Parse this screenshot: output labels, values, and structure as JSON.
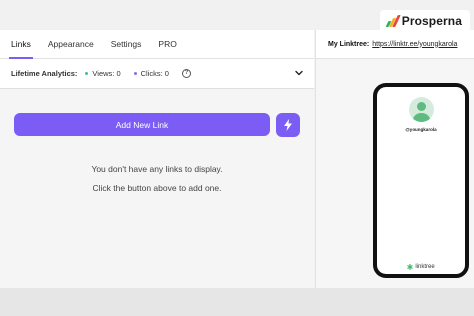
{
  "brand": {
    "name": "Prosperna"
  },
  "tabs": [
    {
      "label": "Links",
      "active": true
    },
    {
      "label": "Appearance",
      "active": false
    },
    {
      "label": "Settings",
      "active": false
    },
    {
      "label": "PRO",
      "active": false
    }
  ],
  "analytics": {
    "label": "Lifetime Analytics:",
    "views": "Views: 0",
    "clicks": "Clicks: 0",
    "help_icon": "?",
    "chevron_icon": "chevron-down-icon"
  },
  "actions": {
    "add_link_label": "Add New Link",
    "bolt_icon": "lightning-icon"
  },
  "empty_state": {
    "line1": "You don't have any links to display.",
    "line2": "Click the button above to add one."
  },
  "preview": {
    "my_linktree_label": "My Linktree:",
    "url": "https://linktr.ee/youngkarola",
    "handle": "@youngkarola",
    "footer": "linktree"
  },
  "colors": {
    "accent": "#7b5cf5",
    "views_dot": "#3fbf9f",
    "clicks_dot": "#8b6cf0",
    "avatar": "#5dbb82"
  }
}
